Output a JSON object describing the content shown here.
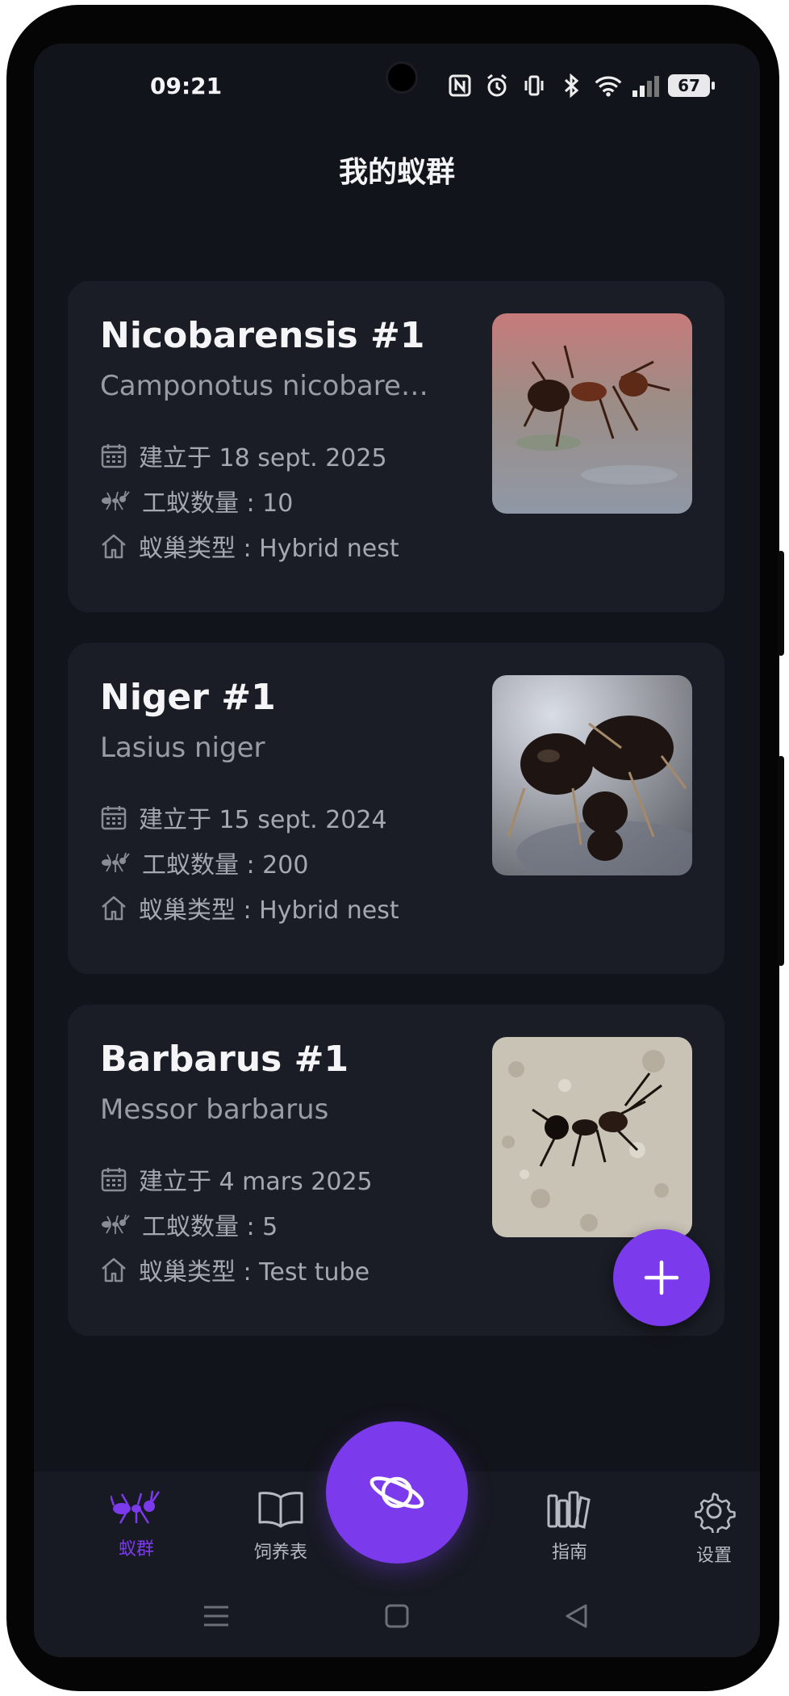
{
  "status_bar": {
    "time": "09:21",
    "battery": "67"
  },
  "header": {
    "title": "我的蚁群"
  },
  "colonies": [
    {
      "name": "Nicobarensis #1",
      "species": "Camponotus nicobarensis",
      "founded": "建立于 18 sept. 2025",
      "workers": "工蚁数量 : 10",
      "nest": "蚁巢类型 : Hybrid nest"
    },
    {
      "name": "Niger #1",
      "species": "Lasius niger",
      "founded": "建立于 15 sept. 2024",
      "workers": "工蚁数量 : 200",
      "nest": "蚁巢类型 : Hybrid nest"
    },
    {
      "name": "Barbarus #1",
      "species": "Messor barbarus",
      "founded": "建立于 4 mars 2025",
      "workers": "工蚁数量 : 5",
      "nest": "蚁巢类型 : Test tube"
    }
  ],
  "nav": {
    "colonies": "蚁群",
    "feeding": "饲养表",
    "guide": "指南",
    "settings": "设置"
  },
  "icons": {
    "calendar": "calendar-icon",
    "ant": "ant-icon",
    "home": "home-icon",
    "add": "plus-icon",
    "center": "planet-icon"
  },
  "colors": {
    "accent": "#7c3aed",
    "background": "#12141b",
    "card": "#1a1d25"
  }
}
